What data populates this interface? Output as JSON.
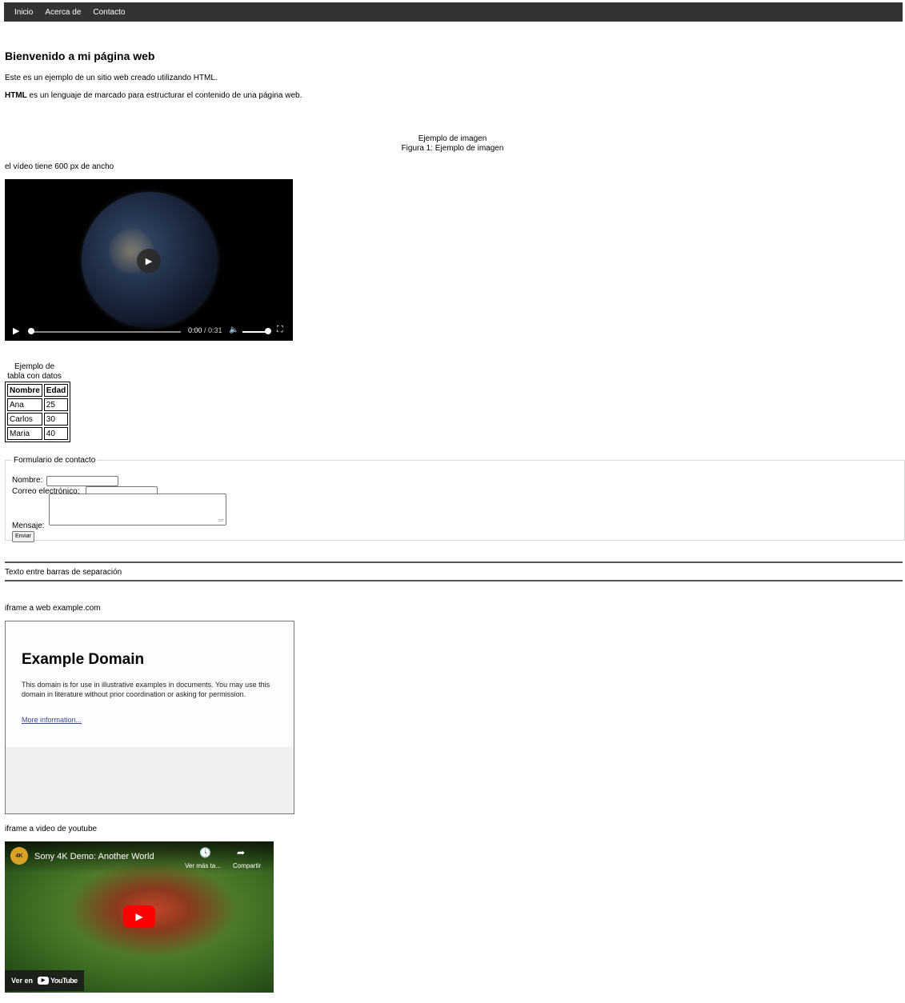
{
  "nav": {
    "items": [
      "Inicio",
      "Acerca de",
      "Contacto"
    ]
  },
  "main": {
    "heading": "Bienvenido a mi página web",
    "intro": "Este es un ejemplo de un sitio web creado utilizando HTML.",
    "html_bold": "HTML",
    "html_rest": " es un lenguaje de marcado para estructurar el contenido de una página web.",
    "image_alt": "Ejemplo de imagen",
    "figcaption": "Figura 1: Ejemplo de imagen",
    "video_label": "el vídeo tiene 600 px de ancho"
  },
  "video": {
    "time_current": "0:00",
    "time_total": "/ 0:31",
    "progress": 0.0,
    "volume": 1.0,
    "icons": [
      "play-icon",
      "volume-icon",
      "fullscreen-icon"
    ]
  },
  "table": {
    "caption": "Ejemplo de tabla con datos",
    "headers": [
      "Nombre",
      "Edad"
    ],
    "rows": [
      [
        "Ana",
        "25"
      ],
      [
        "Carlos",
        "30"
      ],
      [
        "Maria",
        "40"
      ]
    ]
  },
  "form": {
    "legend": "Formulario de contacto",
    "name_label": "Nombre:",
    "email_label": "Correo electrónico:",
    "message_label": "Mensaje:",
    "submit_label": "Enviar"
  },
  "separator_text": "Texto entre barras de separación",
  "iframe_web": {
    "label": "iframe a web example.com",
    "title": "Example Domain",
    "body": "This domain is for use in illustrative examples in documents. You may use this domain in literature without prior coordination or asking for permission.",
    "link": "More information..."
  },
  "iframe_youtube": {
    "label": "iframe a video de youtube",
    "channel_badge": "4K",
    "title": "Sony 4K Demo: Another World",
    "watch_later": "Ver más ta...",
    "share": "Compartir",
    "watch_on": "Ver en",
    "brand": "YouTube"
  },
  "colors": {
    "nav_bg": "#333333",
    "yt_red": "#ff0000",
    "link": "#38488f"
  }
}
